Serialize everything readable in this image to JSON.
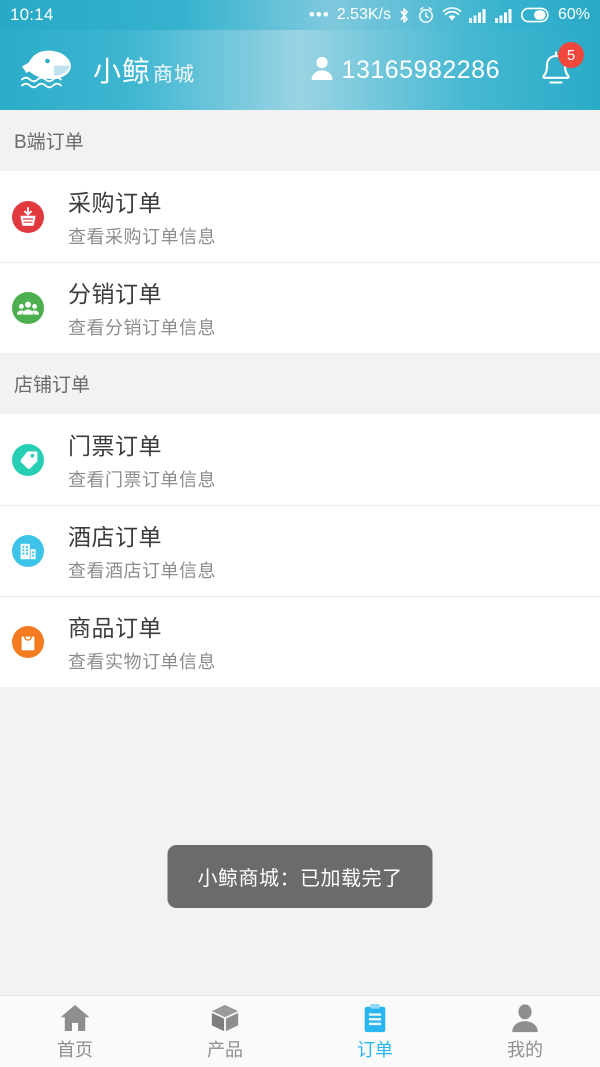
{
  "statusbar": {
    "time": "10:14",
    "dots": "•••",
    "net_speed": "2.53K/s",
    "battery_percent": "60%",
    "icons": [
      "bluetooth-icon",
      "alarm-icon",
      "wifi-icon",
      "signal-icon",
      "signal-icon",
      "battery-icon"
    ]
  },
  "appbar": {
    "logo_icon": "whale-logo-icon",
    "brand_main": "小鲸",
    "brand_sub": "商城",
    "user_icon": "person-icon",
    "phone": "13165982286",
    "bell_icon": "bell-icon",
    "badge_count": "5",
    "badge_color": "#f1483d",
    "gradient_from": "#2aacc8",
    "gradient_mid": "#9ad4e3",
    "gradient_to": "#29abc7"
  },
  "sections": [
    {
      "header": "B端订单",
      "items": [
        {
          "title": "采购订单",
          "subtitle": "查看采购订单信息",
          "icon": "purchase-basket-icon",
          "icon_color": "#e0393e"
        },
        {
          "title": "分销订单",
          "subtitle": "查看分销订单信息",
          "icon": "distribution-group-icon",
          "icon_color": "#4caf50"
        }
      ]
    },
    {
      "header": "店铺订单",
      "items": [
        {
          "title": "门票订单",
          "subtitle": "查看门票订单信息",
          "icon": "ticket-tag-icon",
          "icon_color": "#26cfb4"
        },
        {
          "title": "酒店订单",
          "subtitle": "查看酒店订单信息",
          "icon": "hotel-building-icon",
          "icon_color": "#3ec3e8"
        },
        {
          "title": "商品订单",
          "subtitle": "查看实物订单信息",
          "icon": "shopping-bag-icon",
          "icon_color": "#f47b20"
        }
      ]
    }
  ],
  "toast": {
    "message": "小鲸商城：已加载完了"
  },
  "tabbar": {
    "active_color": "#29b6f0",
    "inactive_color": "#8e8e8e",
    "items": [
      {
        "label": "首页",
        "icon": "home-icon",
        "active": false
      },
      {
        "label": "产品",
        "icon": "box-icon",
        "active": false
      },
      {
        "label": "订单",
        "icon": "clipboard-icon",
        "active": true
      },
      {
        "label": "我的",
        "icon": "person-icon",
        "active": false
      }
    ]
  }
}
